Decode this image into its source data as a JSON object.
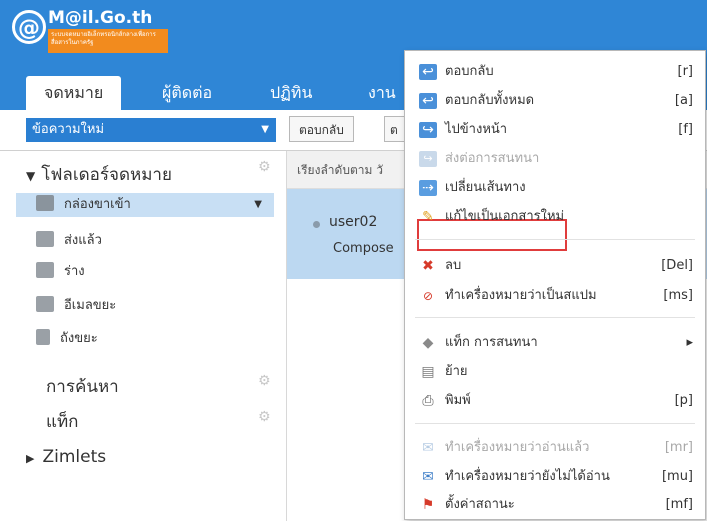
{
  "header": {
    "logo_text": "M@il.Go.th",
    "logo_mark": "@",
    "logo_badge": "ระบบจดหมายอิเล็กทรอนิกส์กลางเพื่อการสื่อสารในภาครัฐ"
  },
  "tabs": [
    {
      "label": "จดหมาย",
      "active": true
    },
    {
      "label": "ผู้ติดต่อ"
    },
    {
      "label": "ปฏิทิน"
    },
    {
      "label": "งาน"
    }
  ],
  "toolbar": {
    "new_message": "ข้อความใหม่",
    "reply": "ตอบกลับ",
    "next_partial": "ต"
  },
  "sidebar": {
    "folders_title": "โฟลเดอร์จดหมาย",
    "folders": [
      {
        "label": "กล่องขาเข้า",
        "selected": true
      },
      {
        "label": "ส่งแล้ว"
      },
      {
        "label": "ร่าง"
      },
      {
        "label": "อีเมลขยะ"
      },
      {
        "label": "ถังขยะ"
      }
    ],
    "search_label": "การค้นหา",
    "tags_label": "แท็ก",
    "zimlets_label": "Zimlets"
  },
  "message_list": {
    "sort_label": "เรียงลำดับตาม วั",
    "sender": "user02",
    "subject": "Compose"
  },
  "context_menu": {
    "items": [
      {
        "label": "ตอบกลับ",
        "shortcut": "[r]",
        "icon": "reply-icon"
      },
      {
        "label": "ตอบกลับทั้งหมด",
        "shortcut": "[a]",
        "icon": "reply-all-icon"
      },
      {
        "label": "ไปข้างหน้า",
        "shortcut": "[f]",
        "icon": "forward-icon"
      },
      {
        "label": "ส่งต่อการสนทนา",
        "shortcut": "",
        "icon": "forward-conversation-icon",
        "disabled": true
      },
      {
        "label": "เปลี่ยนเส้นทาง",
        "shortcut": "",
        "icon": "redirect-icon",
        "highlighted": true
      },
      {
        "label": "แก้ไขเป็นเอกสารใหม่",
        "shortcut": "",
        "icon": "edit-icon"
      },
      {
        "label": "ลบ",
        "shortcut": "[Del]",
        "icon": "delete-icon"
      },
      {
        "label": "ทำเครื่องหมายว่าเป็นสแปม",
        "shortcut": "[ms]",
        "icon": "spam-icon"
      },
      {
        "label": "แท็ก การสนทนา",
        "shortcut": "▸",
        "icon": "tag-icon"
      },
      {
        "label": "ย้าย",
        "shortcut": "",
        "icon": "move-icon"
      },
      {
        "label": "พิมพ์",
        "shortcut": "[p]",
        "icon": "print-icon"
      },
      {
        "label": "ทำเครื่องหมายว่าอ่านแล้ว",
        "shortcut": "[mr]",
        "icon": "mark-read-icon",
        "disabled": true
      },
      {
        "label": "ทำเครื่องหมายว่ายังไม่ได้อ่าน",
        "shortcut": "[mu]",
        "icon": "mark-unread-icon"
      },
      {
        "label": "ตั้งค่าสถานะ",
        "shortcut": "[mf]",
        "icon": "flag-icon"
      }
    ]
  },
  "colors": {
    "header_bg": "#2f86d6",
    "selected_bg": "#c8dff4",
    "highlight_border": "#e03c3c"
  }
}
